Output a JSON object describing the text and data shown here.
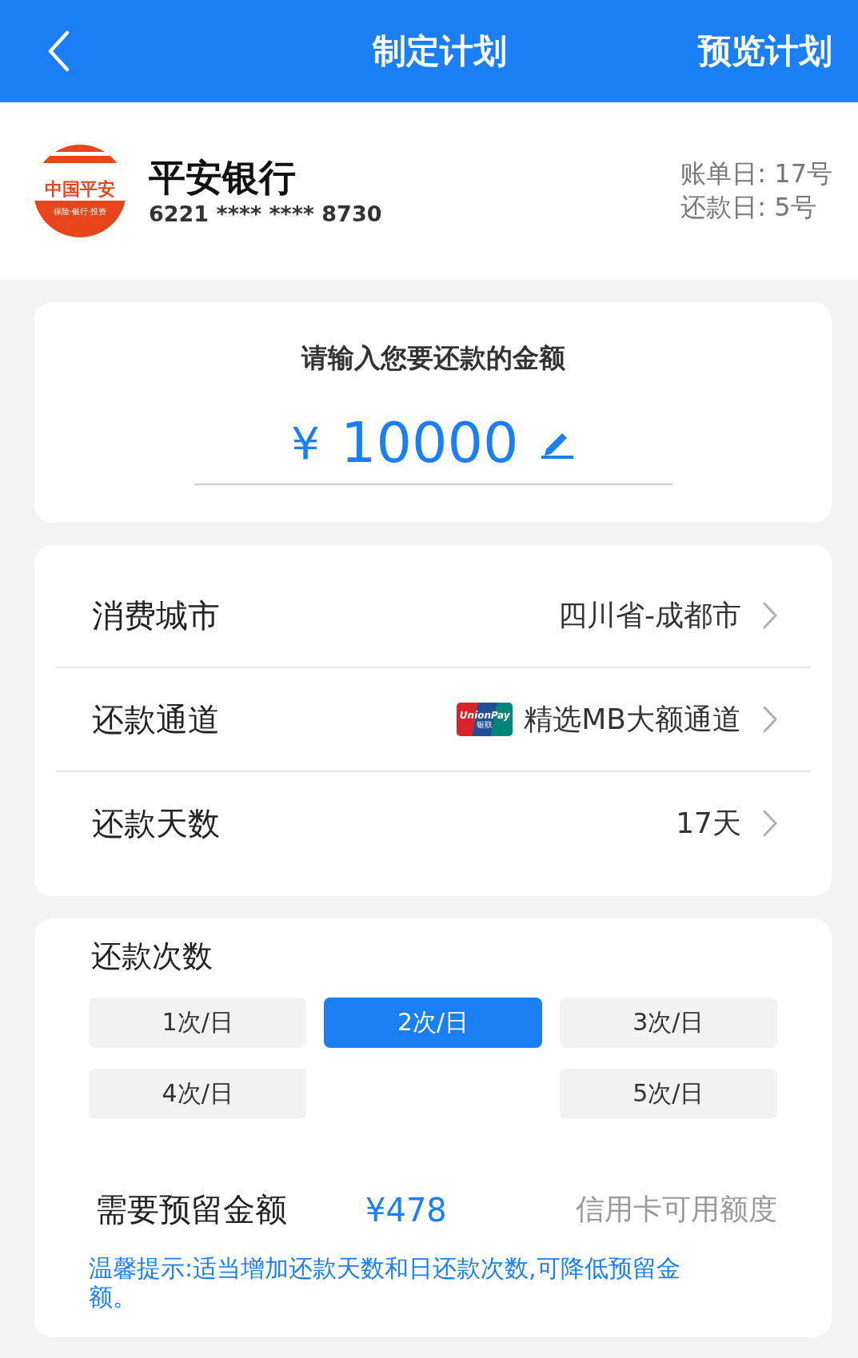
{
  "header": {
    "title": "制定计划",
    "action": "预览计划"
  },
  "bank": {
    "logo": {
      "top": "中国平安",
      "bottom": "保险·银行·投资"
    },
    "name": "平安银行",
    "card_number": "6221 **** **** 8730",
    "bill_day": "账单日: 17号",
    "repay_day": "还款日: 5号"
  },
  "amount": {
    "label": "请输入您要还款的金额",
    "currency": "¥",
    "value": "10000"
  },
  "settings": [
    {
      "label": "消费城市",
      "value": "四川省-成都市",
      "kind": "plain"
    },
    {
      "label": "还款通道",
      "value": "精选MB大额通道",
      "kind": "card",
      "badge": {
        "top": "UnionPay",
        "bottom": "银联"
      }
    },
    {
      "label": "还款天数",
      "value": "17天",
      "kind": "plain"
    }
  ],
  "frequency": {
    "label": "还款次数",
    "options": [
      {
        "label": "1次/日",
        "selected": false
      },
      {
        "label": "2次/日",
        "selected": true
      },
      {
        "label": "3次/日",
        "selected": false
      },
      {
        "label": "4次/日",
        "selected": false
      },
      {
        "label": "5次/日",
        "selected": false
      }
    ]
  },
  "reserve": {
    "label": "需要预留金额",
    "value": "¥478",
    "note": "信用卡可用额度"
  },
  "tip": "温馨提示:适当增加还款天数和日还款次数,可降低预留金额。"
}
